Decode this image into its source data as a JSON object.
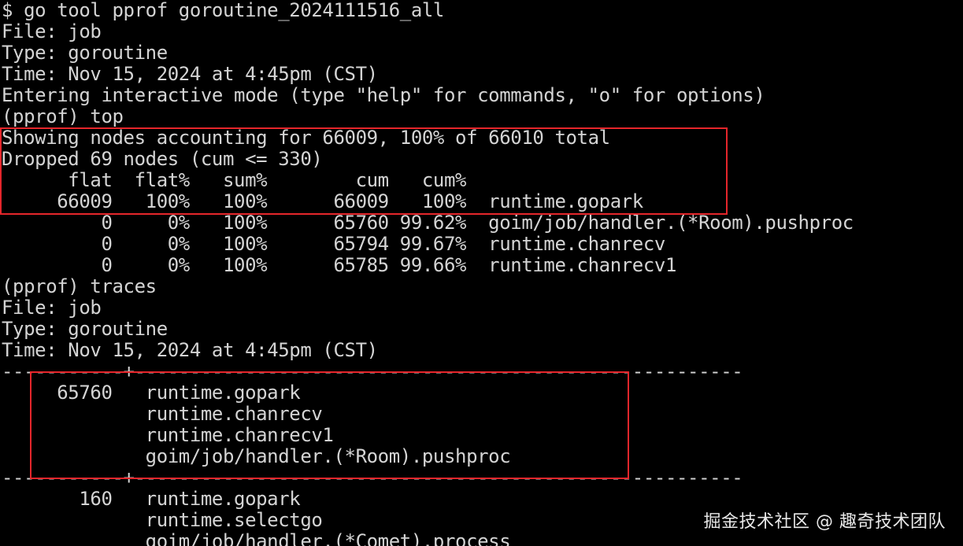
{
  "terminal": {
    "lines": [
      "$ go tool pprof goroutine_2024111516_all",
      "File: job",
      "Type: goroutine",
      "Time: Nov 15, 2024 at 4:45pm (CST)",
      "Entering interactive mode (type \"help\" for commands, \"o\" for options)",
      "(pprof) top",
      "Showing nodes accounting for 66009, 100% of 66010 total",
      "Dropped 69 nodes (cum <= 330)",
      "      flat  flat%   sum%        cum   cum%",
      "     66009   100%   100%      66009   100%  runtime.gopark",
      "         0     0%   100%      65760 99.62%  goim/job/handler.(*Room).pushproc",
      "         0     0%   100%      65794 99.67%  runtime.chanrecv",
      "         0     0%   100%      65785 99.66%  runtime.chanrecv1",
      "(pprof) traces",
      "File: job",
      "Type: goroutine",
      "Time: Nov 15, 2024 at 4:45pm (CST)",
      "-----------+-------------------------------------------------------",
      "     65760   runtime.gopark",
      "             runtime.chanrecv",
      "             runtime.chanrecv1",
      "             goim/job/handler.(*Room).pushproc",
      "-----------+-------------------------------------------------------",
      "       160   runtime.gopark",
      "             runtime.selectgo",
      "             goim/job/handler.(*Comet).process"
    ]
  },
  "watermark": {
    "text": "掘金技术社区 @ 趣奇技术团队"
  },
  "colors": {
    "background": "#000000",
    "text": "#d4d4d4",
    "highlight_border": "#e5262b"
  }
}
